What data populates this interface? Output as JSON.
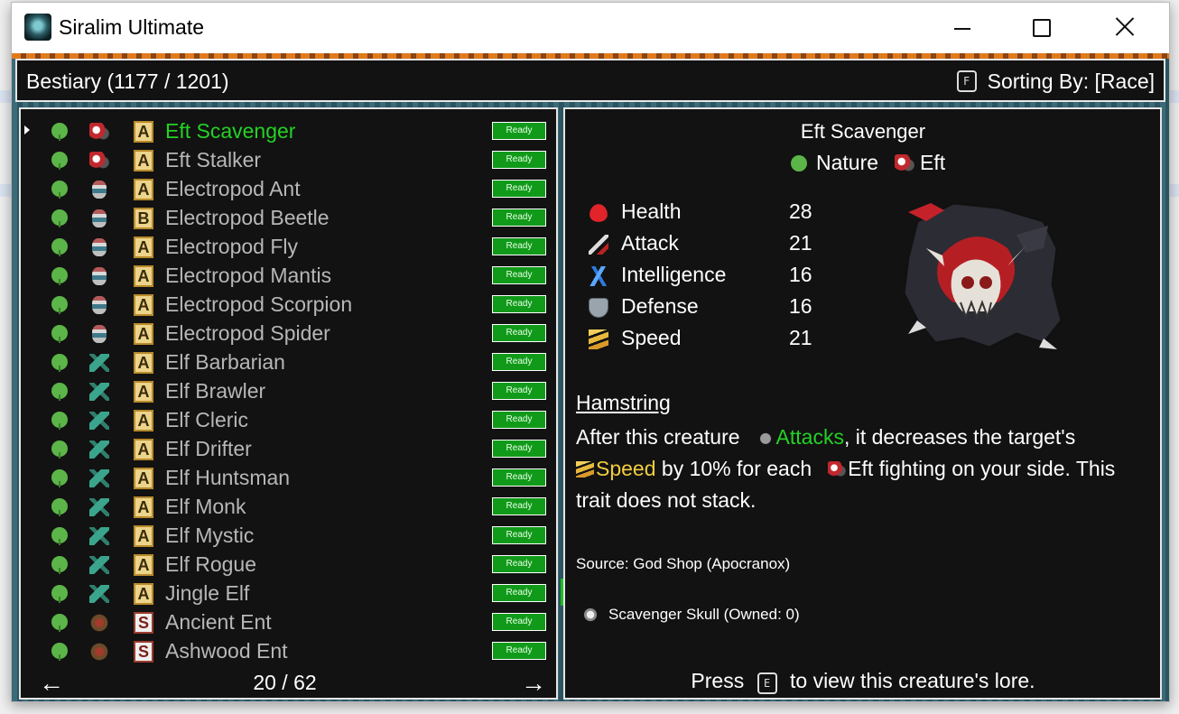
{
  "window": {
    "title": "Siralim Ultimate"
  },
  "header": {
    "title": "Bestiary (1177 / 1201)",
    "sort_key": "F",
    "sort_label": "Sorting By: [Race]"
  },
  "list": {
    "items": [
      {
        "name": "Eft Scavenger",
        "race": "eft",
        "rank": "A",
        "status": "Ready",
        "selected": true
      },
      {
        "name": "Eft Stalker",
        "race": "eft",
        "rank": "A",
        "status": "Ready"
      },
      {
        "name": "Electropod Ant",
        "race": "electro",
        "rank": "A",
        "status": "Ready"
      },
      {
        "name": "Electropod Beetle",
        "race": "electro",
        "rank": "B",
        "status": "Ready"
      },
      {
        "name": "Electropod Fly",
        "race": "electro",
        "rank": "A",
        "status": "Ready"
      },
      {
        "name": "Electropod Mantis",
        "race": "electro",
        "rank": "A",
        "status": "Ready"
      },
      {
        "name": "Electropod Scorpion",
        "race": "electro",
        "rank": "A",
        "status": "Ready"
      },
      {
        "name": "Electropod Spider",
        "race": "electro",
        "rank": "A",
        "status": "Ready"
      },
      {
        "name": "Elf Barbarian",
        "race": "elf",
        "rank": "A",
        "status": "Ready"
      },
      {
        "name": "Elf Brawler",
        "race": "elf",
        "rank": "A",
        "status": "Ready"
      },
      {
        "name": "Elf Cleric",
        "race": "elf",
        "rank": "A",
        "status": "Ready"
      },
      {
        "name": "Elf Drifter",
        "race": "elf",
        "rank": "A",
        "status": "Ready"
      },
      {
        "name": "Elf Huntsman",
        "race": "elf",
        "rank": "A",
        "status": "Ready"
      },
      {
        "name": "Elf Monk",
        "race": "elf",
        "rank": "A",
        "status": "Ready"
      },
      {
        "name": "Elf Mystic",
        "race": "elf",
        "rank": "A",
        "status": "Ready"
      },
      {
        "name": "Elf Rogue",
        "race": "elf",
        "rank": "A",
        "status": "Ready"
      },
      {
        "name": "Jingle Elf",
        "race": "elf",
        "rank": "A",
        "status": "Ready"
      },
      {
        "name": "Ancient Ent",
        "race": "ent",
        "rank": "S",
        "status": "Ready"
      },
      {
        "name": "Ashwood Ent",
        "race": "ent",
        "rank": "S",
        "status": "Ready"
      }
    ],
    "page": "20 / 62",
    "prev_arrow": "←",
    "next_arrow": "→"
  },
  "detail": {
    "name": "Eft Scavenger",
    "klass": "Nature",
    "race": "Eft",
    "stats": [
      {
        "label": "Health",
        "value": "28",
        "icon": "heart-icon"
      },
      {
        "label": "Attack",
        "value": "21",
        "icon": "sword-icon"
      },
      {
        "label": "Intelligence",
        "value": "16",
        "icon": "lightning-icon"
      },
      {
        "label": "Defense",
        "value": "16",
        "icon": "shield-icon"
      },
      {
        "label": "Speed",
        "value": "21",
        "icon": "wing-icon"
      }
    ],
    "trait_name": "Hamstring",
    "trait": {
      "p1": "After this creature",
      "attacks": "Attacks",
      "p2": ", it decreases the target's",
      "speed": "Speed",
      "p3": " by 10% for each",
      "p4": "Eft fighting on your side. This trait does not stack."
    },
    "source": "Source: God Shop (Apocranox)",
    "item": "Scavenger Skull (Owned: 0)",
    "lore_press": "Press",
    "lore_key": "E",
    "lore_rest": "to view this creature's lore."
  },
  "colors": {
    "selected": "#25d125",
    "speed": "#f2cd3e",
    "status_bg": "#119a1a"
  }
}
